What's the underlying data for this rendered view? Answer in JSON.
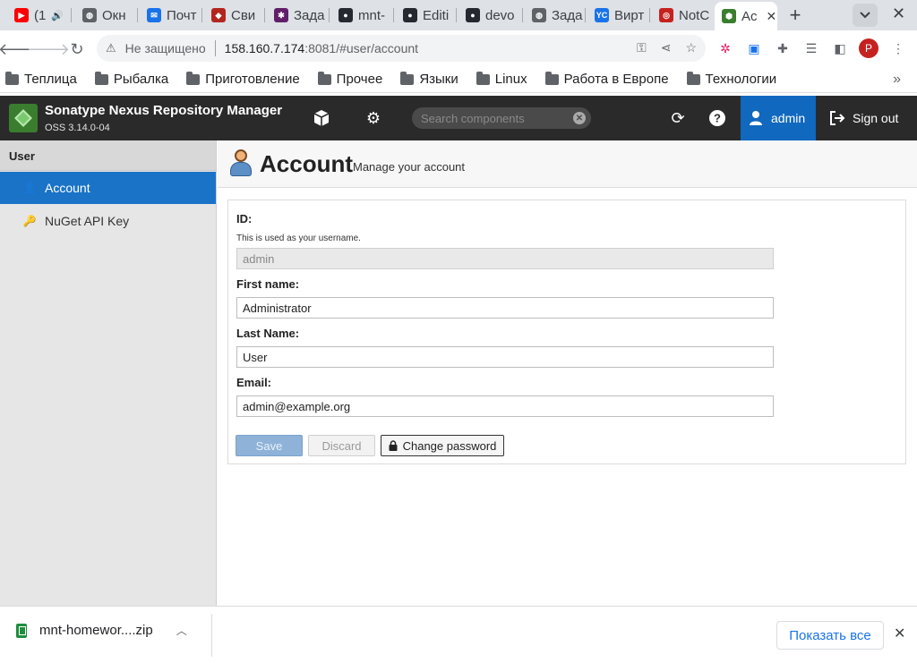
{
  "browser": {
    "tabs": [
      {
        "label": "(1",
        "icon": "youtube-icon",
        "color": "#ff0000",
        "glyph": "▶"
      },
      {
        "label": "Окн",
        "icon": "globe-icon",
        "color": "#5f6368",
        "glyph": "◍"
      },
      {
        "label": "Почт",
        "icon": "mail-icon",
        "color": "#1a73e8",
        "glyph": "✉"
      },
      {
        "label": "Сви",
        "icon": "app-icon",
        "color": "#b3261e",
        "glyph": "◆"
      },
      {
        "label": "Зада",
        "icon": "slack-icon",
        "color": "#611f69",
        "glyph": "✱"
      },
      {
        "label": "mnt-",
        "icon": "github-icon",
        "color": "#24292f",
        "glyph": "●"
      },
      {
        "label": "Editi",
        "icon": "github-icon",
        "color": "#24292f",
        "glyph": "●"
      },
      {
        "label": "devo",
        "icon": "github-icon",
        "color": "#24292f",
        "glyph": "●"
      },
      {
        "label": "Зада",
        "icon": "globe-icon",
        "color": "#5f6368",
        "glyph": "◍"
      },
      {
        "label": "Вирт",
        "icon": "yandex-cloud-icon",
        "color": "#1a73e8",
        "glyph": "YC"
      },
      {
        "label": "NotC",
        "icon": "notc-icon",
        "color": "#c5221f",
        "glyph": "◎"
      },
      {
        "label": "Ac",
        "icon": "nexus-icon",
        "color": "#3a7d2f",
        "glyph": "⬢"
      }
    ],
    "address": {
      "insecure_label": "Не защищено",
      "url_host": "158.160.7.174",
      "url_rest": ":8081/#user/account"
    },
    "bookmarks": [
      "Теплица",
      "Рыбалка",
      "Приготовление",
      "Прочее",
      "Языки",
      "Linux",
      "Работа в Европе",
      "Технологии"
    ],
    "profile_initial": "P"
  },
  "nexus": {
    "title": "Sonatype Nexus Repository Manager",
    "version": "OSS 3.14.0-04",
    "search_placeholder": "Search components",
    "user_label": "admin",
    "signout_label": "Sign out"
  },
  "sidebar": {
    "header": "User",
    "items": [
      {
        "label": "Account",
        "active": true
      },
      {
        "label": "NuGet API Key",
        "active": false
      }
    ]
  },
  "page": {
    "title": "Account",
    "subtitle": "Manage your account"
  },
  "form": {
    "id_label": "ID:",
    "id_help": "This is used as your username.",
    "id_value": "admin",
    "first_name_label": "First name:",
    "first_name_value": "Administrator",
    "last_name_label": "Last Name:",
    "last_name_value": "User",
    "email_label": "Email:",
    "email_value": "admin@example.org",
    "save_label": "Save",
    "discard_label": "Discard",
    "change_password_label": "Change password"
  },
  "downloads": {
    "file_name": "mnt-homewor....zip",
    "show_all_label": "Показать все"
  }
}
